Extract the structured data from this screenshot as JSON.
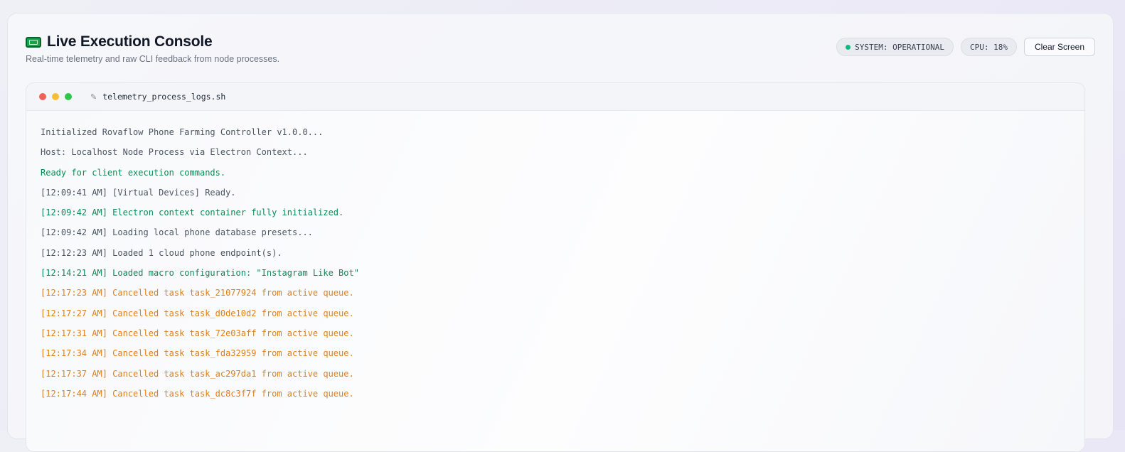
{
  "header": {
    "title": "Live Execution Console",
    "subtitle": "Real-time telemetry and raw CLI feedback from node processes.",
    "icon": "terminal-icon"
  },
  "controls": {
    "status": "SYSTEM: OPERATIONAL",
    "cpu": "CPU: 18%",
    "clear_label": "Clear Screen"
  },
  "terminal": {
    "filename": "telemetry_process_logs.sh",
    "file_icon": "✎"
  },
  "colors": {
    "info": "#4b5563",
    "success": "#0b8a55",
    "warn": "#e07f1a",
    "status_dot": "#10b981"
  },
  "logs": [
    {
      "text": "Initialized Rovaflow Phone Farming Controller v1.0.0...",
      "level": "info"
    },
    {
      "text": "Host: Localhost Node Process via Electron Context...",
      "level": "info"
    },
    {
      "text": "Ready for client execution commands.",
      "level": "success"
    },
    {
      "text": "[12:09:41 AM] [Virtual Devices] Ready.",
      "level": "info"
    },
    {
      "text": "[12:09:42 AM] Electron context container fully initialized.",
      "level": "success"
    },
    {
      "text": "[12:09:42 AM] Loading local phone database presets...",
      "level": "info"
    },
    {
      "text": "[12:12:23 AM] Loaded 1 cloud phone endpoint(s).",
      "level": "info"
    },
    {
      "text": "[12:14:21 AM] Loaded macro configuration: \"Instagram Like Bot\"",
      "level": "success"
    },
    {
      "text": "[12:17:23 AM] Cancelled task task_21077924 from active queue.",
      "level": "warn"
    },
    {
      "text": "[12:17:27 AM] Cancelled task task_d0de10d2 from active queue.",
      "level": "warn"
    },
    {
      "text": "[12:17:31 AM] Cancelled task task_72e03aff from active queue.",
      "level": "warn"
    },
    {
      "text": "[12:17:34 AM] Cancelled task task_fda32959 from active queue.",
      "level": "warn"
    },
    {
      "text": "[12:17:37 AM] Cancelled task task_ac297da1 from active queue.",
      "level": "warn"
    },
    {
      "text": "[12:17:44 AM] Cancelled task task_dc8c3f7f from active queue.",
      "level": "warn"
    }
  ]
}
